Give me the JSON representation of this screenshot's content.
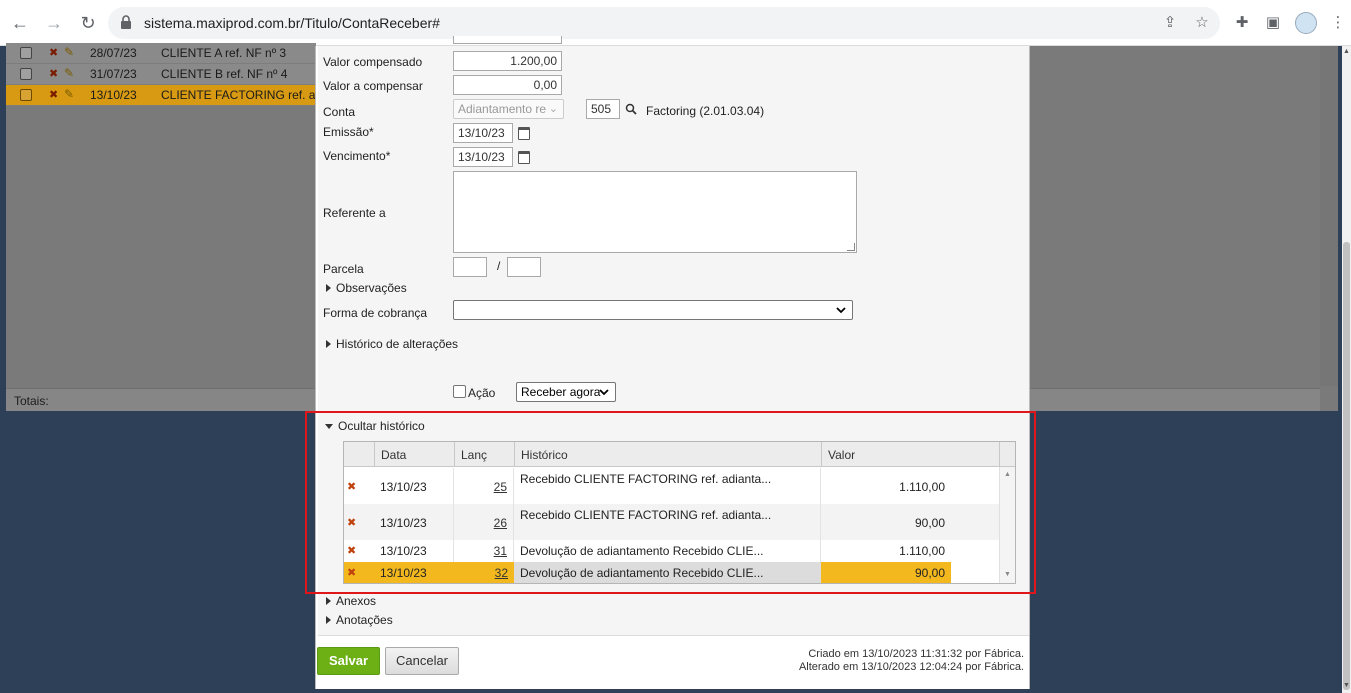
{
  "browser": {
    "url": "sistema.maxiprod.com.br/Titulo/ContaReceber#"
  },
  "background_grid": {
    "rows": [
      {
        "date": "28/07/23",
        "client": "CLIENTE A ref. NF nº 3",
        "selected": false
      },
      {
        "date": "31/07/23",
        "client": "CLIENTE B ref. NF nº 4",
        "selected": false
      },
      {
        "date": "13/10/23",
        "client": "CLIENTE FACTORING ref. adiantamento",
        "selected": true
      }
    ],
    "totals_label": "Totais:"
  },
  "form": {
    "valor_compensado_label": "Valor compensado",
    "valor_compensado_value": "1.200,00",
    "valor_a_compensar_label": "Valor a compensar",
    "valor_a_compensar_value": "0,00",
    "conta_label": "Conta",
    "conta_select_value": "Adiantamento re",
    "conta_code": "505",
    "conta_name": "Factoring (2.01.03.04)",
    "emissao_label": "Emissão*",
    "emissao_value": "13/10/23",
    "vencimento_label": "Vencimento*",
    "vencimento_value": "13/10/23",
    "referente_label": "Referente a",
    "referente_value": "",
    "parcela_label": "Parcela",
    "parcela_sep": "/",
    "observacoes_label": "Observações",
    "forma_cobranca_label": "Forma de cobrança",
    "forma_cobranca_value": "",
    "historico_alteracoes_label": "Histórico de alterações",
    "acao_label": "Ação",
    "acao_select_value": "Receber agora"
  },
  "historico": {
    "toggle_label": "Ocultar histórico",
    "columns": [
      "Data",
      "Lanç",
      "Histórico",
      "Valor"
    ],
    "rows": [
      {
        "data": "13/10/23",
        "lanc": "25",
        "historico": "Recebido CLIENTE FACTORING ref. adianta...",
        "valor": "1.110,00",
        "selected": false
      },
      {
        "data": "13/10/23",
        "lanc": "26",
        "historico": "Recebido CLIENTE FACTORING ref. adianta...",
        "valor": "90,00",
        "selected": false
      },
      {
        "data": "13/10/23",
        "lanc": "31",
        "historico": "Devolução de adiantamento Recebido CLIE...",
        "valor": "1.110,00",
        "selected": false
      },
      {
        "data": "13/10/23",
        "lanc": "32",
        "historico": "Devolução de adiantamento Recebido CLIE...",
        "valor": "90,00",
        "selected": true
      }
    ]
  },
  "anexos_label": "Anexos",
  "anotacoes_label": "Anotações",
  "buttons": {
    "save": "Salvar",
    "cancel": "Cancelar"
  },
  "footer": {
    "criado": "Criado em 13/10/2023 11:31:32 por Fábrica.",
    "alterado": "Alterado em 13/10/2023 12:04:24 por Fábrica."
  },
  "colors": {
    "selected_row": "#f2b81e",
    "save_button": "#6cb016",
    "highlight_box": "#e0161a"
  }
}
